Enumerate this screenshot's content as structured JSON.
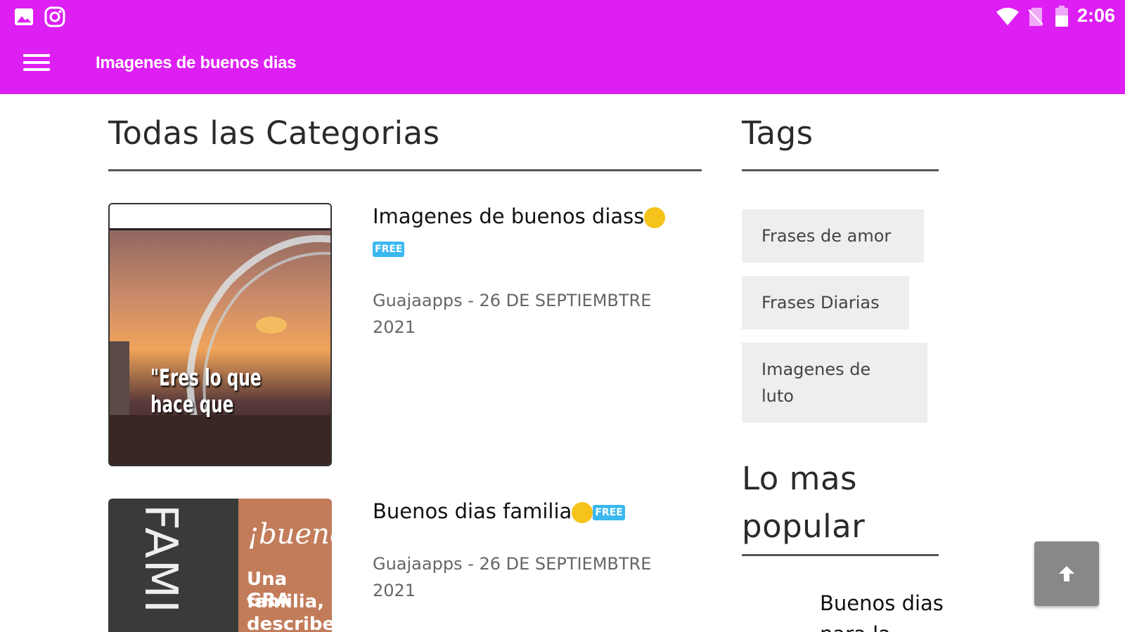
{
  "status_bar": {
    "time": "2:06",
    "icons": [
      "image-icon",
      "instagram-icon",
      "wifi-icon",
      "no-sim-icon",
      "battery-icon"
    ]
  },
  "app_bar": {
    "title": "Imagenes de buenos dias",
    "menu_icon": "hamburger-menu-icon",
    "color": "#dd1ff3"
  },
  "main": {
    "heading": "Todas las Categorias",
    "posts": [
      {
        "title_line1": "Imagenes de buenos diass",
        "badge": "FREE",
        "meta": "Guajaapps - 26 DE SEPTIEMBTRE 2021",
        "thumb_text": "\"Eres lo que hace que dices que h"
      },
      {
        "title_line1": "Buenos dias familia",
        "badge": "FREE",
        "meta": "Guajaapps - 26 DE SEPTIEMBTRE 2021",
        "thumb_text_left": "FAMI",
        "thumb_text_right_1": "¡bueno",
        "thumb_text_right_2": "Una GRA",
        "thumb_text_right_3": "familia,",
        "thumb_text_right_4": "describe"
      }
    ]
  },
  "sidebar": {
    "tags_heading": "Tags",
    "tags": [
      "Frases de amor",
      "Frases Diarias",
      "Imagenes de luto"
    ],
    "popular_heading": "Lo mas popular",
    "popular_first_title": "Buenos dias para la"
  },
  "scroll_top_icon": "arrow-up-icon"
}
